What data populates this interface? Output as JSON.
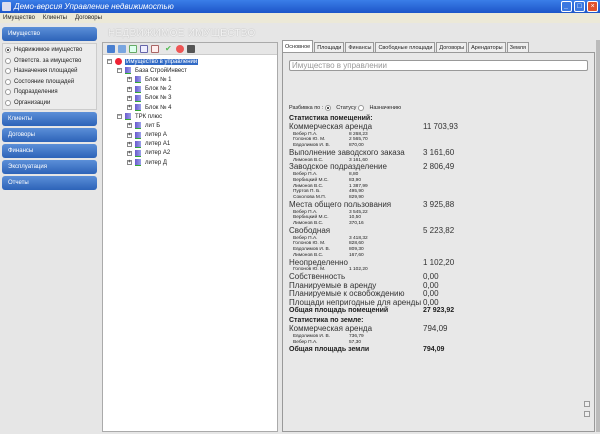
{
  "window": {
    "title": "Демо-версия Управление недвижимостью"
  },
  "menu": [
    "Имущество",
    "Клиенты",
    "Договоры"
  ],
  "sidebar": {
    "active_group": "Имущество",
    "options": [
      {
        "label": "Недвижимое имущество",
        "selected": true
      },
      {
        "label": "Ответств. за имущество",
        "selected": false
      },
      {
        "label": "Назначения площадей",
        "selected": false
      },
      {
        "label": "Состояние площадей",
        "selected": false
      },
      {
        "label": "Подразделения",
        "selected": false
      },
      {
        "label": "Организации",
        "selected": false
      }
    ],
    "groups": [
      "Клиенты",
      "Договоры",
      "Финансы",
      "Эксплуатация",
      "Отчеты"
    ]
  },
  "heading": "НЕДВИЖИМОЕ ИМУЩЕСТВО",
  "tree": {
    "root": "Имущество в управлении",
    "nodes": [
      {
        "label": "База СтройИнвест",
        "children": [
          "Блок № 1",
          "Блок № 2",
          "Блок № 3",
          "Блок № 4"
        ]
      },
      {
        "label": "ТРК плюс",
        "children": [
          "лит Б",
          "литер А",
          "литер А1",
          "литер А2",
          "литер Д"
        ]
      }
    ]
  },
  "tabs": [
    "Основное",
    "Площади",
    "Финансы",
    "Свободные площади",
    "Договоры",
    "Арендаторы",
    "Земля"
  ],
  "main": {
    "placeholder": "Имущество в управлении",
    "split_label": "Разбивка по :",
    "split_options": [
      "Статусу",
      "Назначению"
    ],
    "stats_title": "Статистика помещений:",
    "categories": [
      {
        "name": "Коммерческая аренда",
        "value": "11 703,93",
        "people": [
          [
            "Вебер П.А.",
            "8 268,23"
          ],
          [
            "Голонов Ю. М.",
            "2 565,70"
          ],
          [
            "Евдолимов И. В.",
            "870,00"
          ]
        ]
      },
      {
        "name": "Выполнение заводского заказа",
        "value": "3 161,60",
        "people": [
          [
            "Лимонов В.С.",
            "3 161,60"
          ]
        ]
      },
      {
        "name": "Заводское подразделение",
        "value": "2 806,49",
        "people": [
          [
            "Вебер П.А.",
            "8,80"
          ],
          [
            "Вербицкий М.С.",
            "83,90"
          ],
          [
            "Лимонов В.С.",
            "1 387,99"
          ],
          [
            "Пуртов П. Б.",
            "495,90"
          ],
          [
            "Соколова М.П.",
            "829,90"
          ]
        ]
      },
      {
        "name": "Места общего пользования",
        "value": "3 925,88",
        "people": [
          [
            "Вебер П.А.",
            "3 545,22"
          ],
          [
            "Вербицкий М.С.",
            "10,50"
          ],
          [
            "Лимонов В.С.",
            "370,16"
          ]
        ]
      },
      {
        "name": "Свободная",
        "value": "5 223,82",
        "people": [
          [
            "Вебер П.А.",
            "3 418,32"
          ],
          [
            "Голонов Ю. М.",
            "828,60"
          ],
          [
            "Евдолимов И. В.",
            "809,30"
          ],
          [
            "Лимонов В.С.",
            "167,60"
          ]
        ]
      },
      {
        "name": "Неопределенно",
        "value": "1 102,20",
        "people": [
          [
            "Голонов Ю. М.",
            "1 102,20"
          ]
        ]
      },
      {
        "name": "Собственность",
        "value": "0,00",
        "people": []
      },
      {
        "name": "Планируемые в аренду",
        "value": "0,00",
        "people": []
      },
      {
        "name": "Планируемые к освобождению",
        "value": "0,00",
        "people": []
      },
      {
        "name": "Площади непригодные для аренды",
        "value": "0,00",
        "people": []
      }
    ],
    "total_label": "Общая площадь помещений",
    "total_value": "27 923,92",
    "land_title": "Статистика по земле:",
    "land": [
      {
        "name": "Коммерческая аренда",
        "value": "794,09",
        "people": [
          [
            "Евдолимов И. В.",
            "736,79"
          ],
          [
            "Вебер П.А.",
            "57,30"
          ]
        ]
      }
    ],
    "land_total_label": "Общая площадь земли",
    "land_total_value": "794,09"
  }
}
